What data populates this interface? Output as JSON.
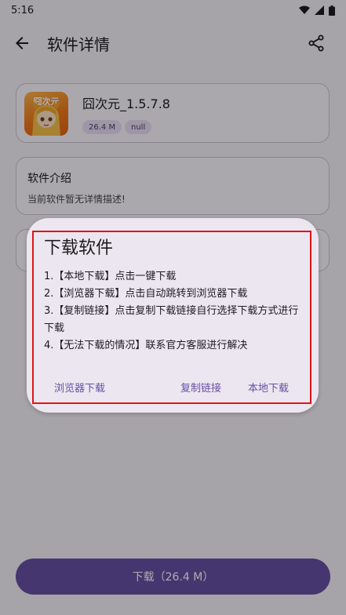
{
  "status_bar": {
    "time": "5:16"
  },
  "app_bar": {
    "title": "软件详情"
  },
  "app_card": {
    "icon_text": "囧次元",
    "name": "囧次元_1.5.7.8",
    "size_chip": "26.4 M",
    "null_chip": "null"
  },
  "intro_card": {
    "title": "软件介绍",
    "description": "当前软件暂无详情描述!"
  },
  "dialog": {
    "title": "下载软件",
    "lines": [
      "1.【本地下载】点击一键下载",
      "2.【浏览器下载】点击自动跳转到浏览器下载",
      "3.【复制链接】点击复制下载链接自行选择下载方式进行下载",
      "4.【无法下载的情况】联系官方客服进行解决"
    ],
    "buttons": {
      "browser": "浏览器下载",
      "copy": "复制链接",
      "local": "本地下载"
    }
  },
  "bottom_button": {
    "label": "下载（26.4 M）"
  },
  "colors": {
    "primary": "#6750a4",
    "chip_bg": "#e8def8",
    "dialog_bg": "#ece6f0",
    "highlight": "#e01515"
  }
}
